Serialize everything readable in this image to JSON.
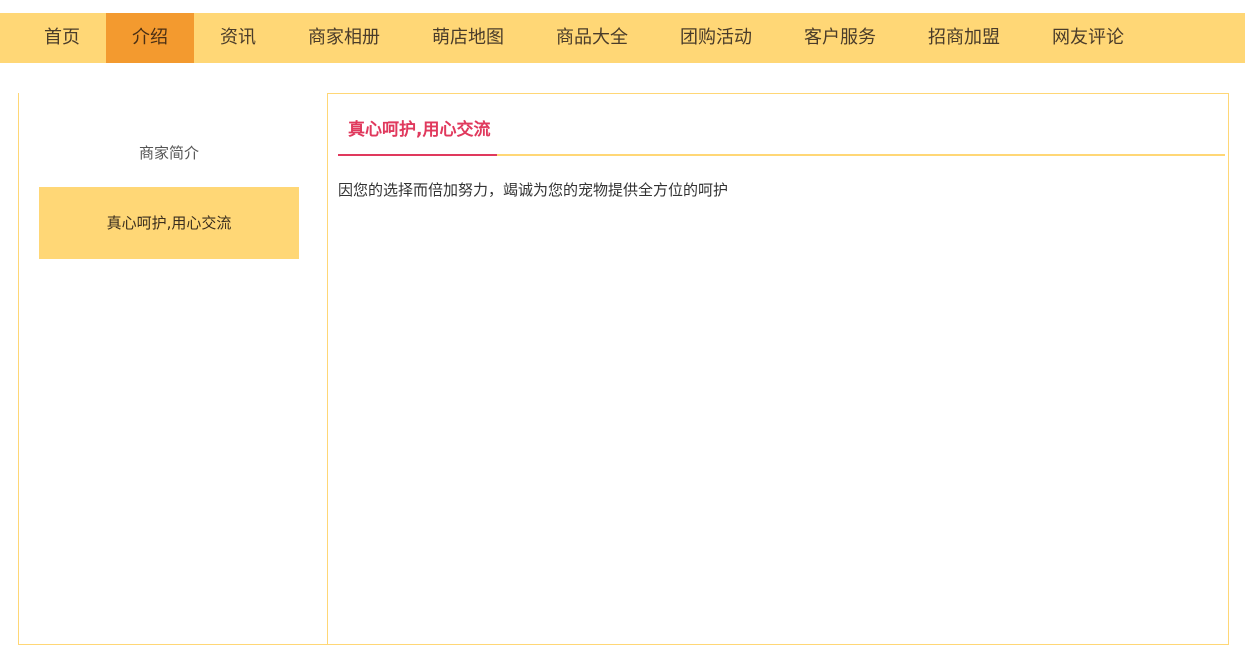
{
  "nav": {
    "items": [
      {
        "label": "首页"
      },
      {
        "label": "介绍"
      },
      {
        "label": "资讯"
      },
      {
        "label": "商家相册"
      },
      {
        "label": "萌店地图"
      },
      {
        "label": "商品大全"
      },
      {
        "label": "团购活动"
      },
      {
        "label": "客户服务"
      },
      {
        "label": "招商加盟"
      },
      {
        "label": "网友评论"
      }
    ],
    "active_index": 1
  },
  "sidebar": {
    "items": [
      {
        "label": "商家简介"
      },
      {
        "label": "真心呵护,用心交流"
      }
    ],
    "active_index": 1
  },
  "content": {
    "title": "真心呵护,用心交流",
    "body": "因您的选择而倍加努力，竭诚为您的宠物提供全方位的呵护"
  },
  "colors": {
    "nav_bg": "#ffd776",
    "nav_active_bg": "#f39a2f",
    "accent": "#e0395d",
    "border": "#ffd776"
  }
}
